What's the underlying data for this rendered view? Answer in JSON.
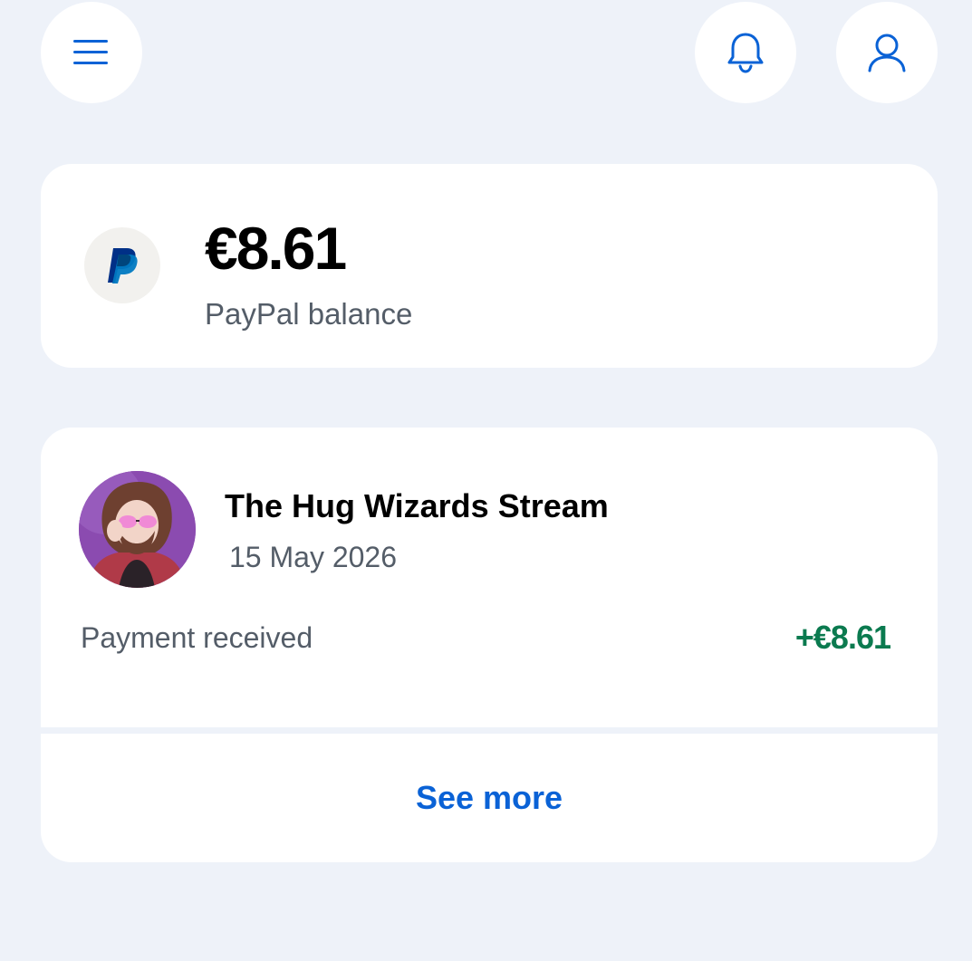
{
  "header": {
    "menu_icon": "hamburger-menu-icon",
    "notifications_icon": "bell-icon",
    "profile_icon": "user-icon",
    "icon_color": "#0a62d6"
  },
  "balance": {
    "amount": "€8.61",
    "label": "PayPal balance",
    "logo": "paypal-logo"
  },
  "activity": {
    "transactions": [
      {
        "name": "The Hug Wizards Stream",
        "date": "15 May 2026",
        "type": "Payment received",
        "amount": "+€8.61",
        "amount_color": "#0b7a4f"
      }
    ],
    "see_more_label": "See more"
  },
  "colors": {
    "background": "#eef2f9",
    "card": "#ffffff",
    "accent": "#0a62d6",
    "positive": "#0b7a4f",
    "secondary_text": "#545d68"
  }
}
